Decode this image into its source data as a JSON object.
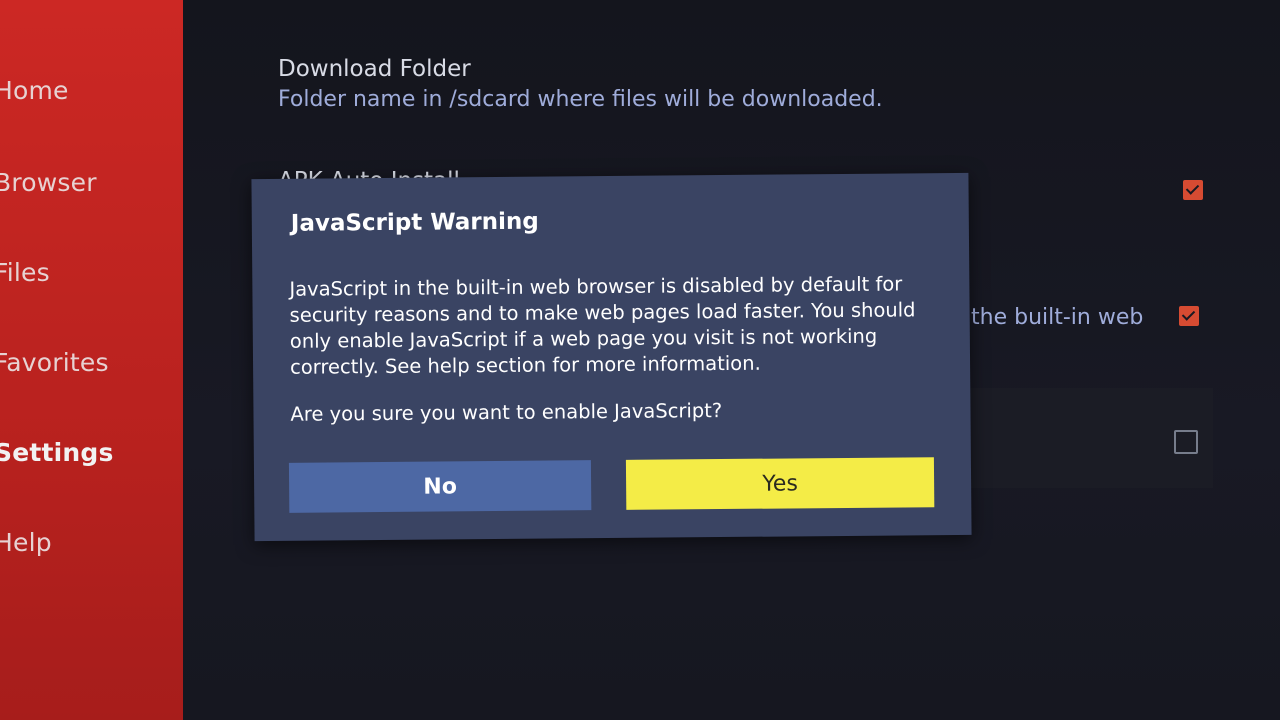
{
  "sidebar": {
    "items": [
      {
        "label": "Home",
        "active": false
      },
      {
        "label": "Browser",
        "active": false
      },
      {
        "label": "Files",
        "active": false
      },
      {
        "label": "Favorites",
        "active": false
      },
      {
        "label": "Settings",
        "active": true
      },
      {
        "label": "Help",
        "active": false
      }
    ]
  },
  "settings": {
    "download_folder": {
      "title": "Download Folder",
      "description": "Folder name in /sdcard where files will be downloaded."
    },
    "apk_auto_install": {
      "title": "APK Auto Install",
      "checked": true
    },
    "javascript": {
      "partial_description": "the built-in web",
      "checked": true
    },
    "third_option": {
      "checked": false
    }
  },
  "dialog": {
    "title": "JavaScript Warning",
    "body": "JavaScript in the built-in web browser is disabled by default for security reasons and to make web pages load faster. You should only enable JavaScript if a web page you visit is not working correctly. See help section for more information.",
    "question": "Are you sure you want to enable JavaScript?",
    "no_label": "No",
    "yes_label": "Yes"
  },
  "colors": {
    "sidebar": "#d72b26",
    "dialog_bg": "#3a4463",
    "no_button": "#4d68a4",
    "yes_button": "#f4ec47",
    "checkbox_checked": "#e25035"
  }
}
